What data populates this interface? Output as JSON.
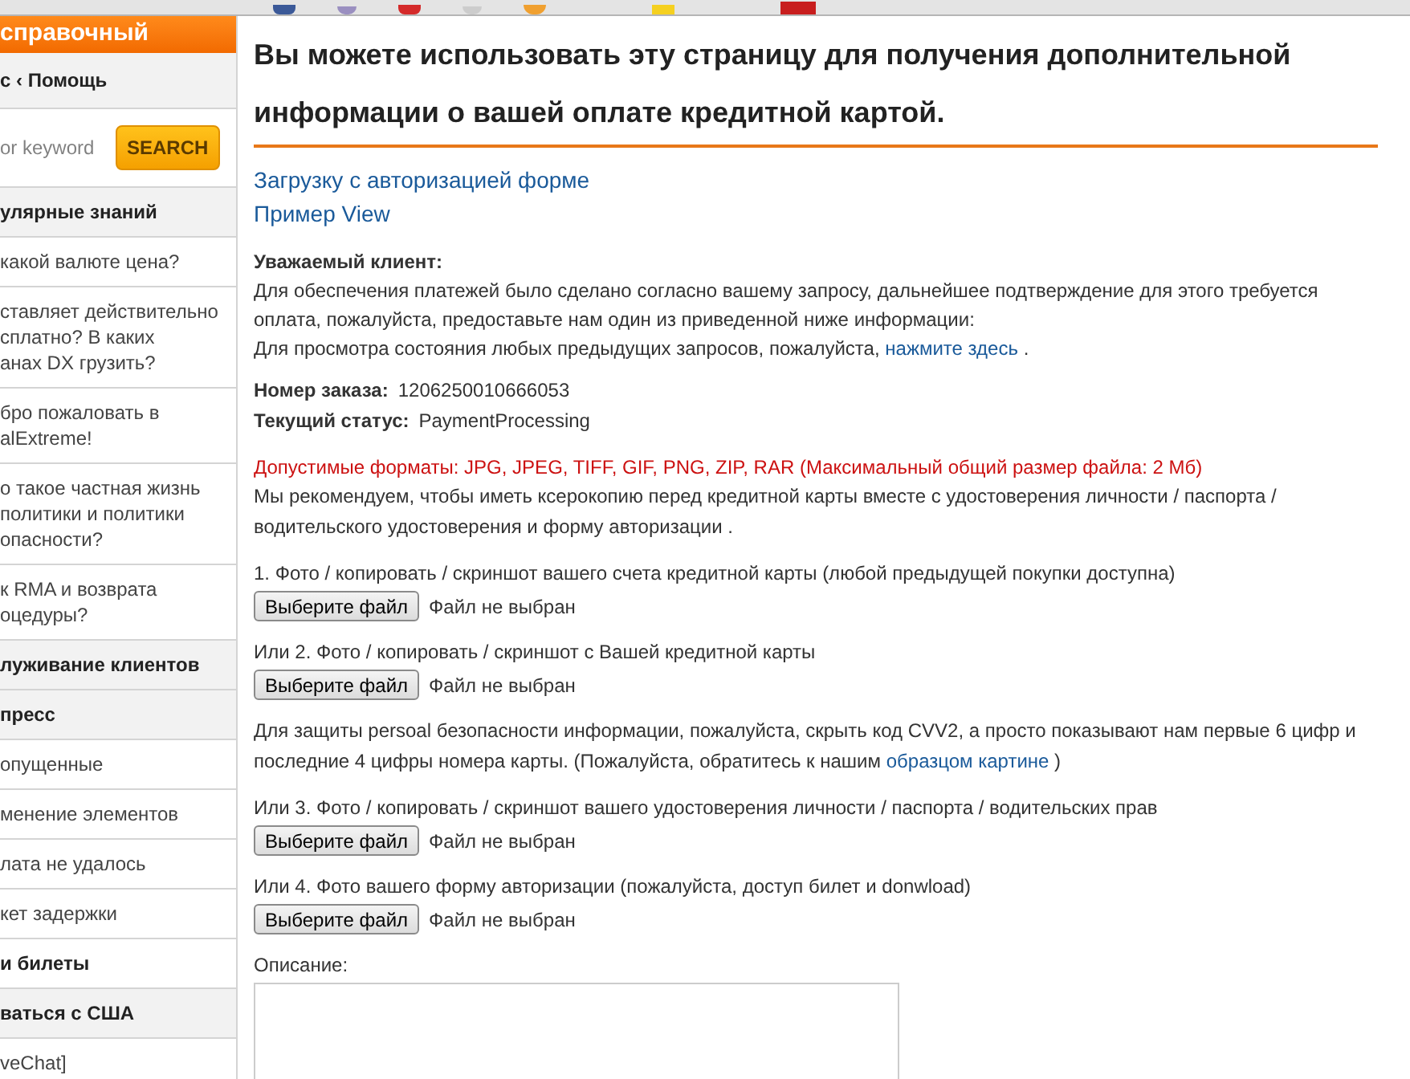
{
  "sidebar": {
    "title": "справочный",
    "breadcrumb": "с ‹ Помощь",
    "search": {
      "placeholder": "or keyword",
      "button": "SEARCH"
    },
    "items": [
      {
        "kind": "heading",
        "lines": [
          "улярные знаний"
        ]
      },
      {
        "kind": "link",
        "lines": [
          "какой валюте цена?"
        ]
      },
      {
        "kind": "link",
        "lines": [
          "ставляет действительно",
          "сплатно? В каких",
          "анах DX грузить?"
        ]
      },
      {
        "kind": "link",
        "lines": [
          "бро пожаловать в",
          "alExtreme!"
        ]
      },
      {
        "kind": "link",
        "lines": [
          "о такое частная жизнь",
          "политики и политики",
          "опасности?"
        ]
      },
      {
        "kind": "link",
        "lines": [
          "к RMA и возврата",
          "оцедуры?"
        ]
      },
      {
        "kind": "heading",
        "lines": [
          "луживание клиентов"
        ]
      },
      {
        "kind": "heading",
        "lines": [
          "пресс"
        ]
      },
      {
        "kind": "link",
        "lines": [
          "опущенные"
        ]
      },
      {
        "kind": "link",
        "lines": [
          "менение элементов"
        ]
      },
      {
        "kind": "link",
        "lines": [
          "лата не удалось"
        ]
      },
      {
        "kind": "link",
        "lines": [
          "кет задержки"
        ]
      },
      {
        "kind": "bold",
        "lines": [
          "и билеты"
        ]
      },
      {
        "kind": "heading",
        "lines": [
          "ваться с США"
        ]
      },
      {
        "kind": "link",
        "lines": [
          "veChat]"
        ]
      }
    ]
  },
  "main": {
    "title": "Вы можете использовать эту страницу для получения дополнительной информации о вашей оплате кредитной картой.",
    "links": [
      "Загрузку с авторизацией форме",
      "Пример View"
    ],
    "greeting": "Уважаемый клиент:",
    "intro": [
      "Для обеспечения платежей было сделано согласно вашему запросу, дальнейшее подтверждение для этого требуется оплата, пожалуйста, предоставьте нам один из приведенной ниже информации:"
    ],
    "status_line": {
      "text": "Для просмотра состояния любых предыдущих запросов, пожалуйста,",
      "link": "нажмите здесь",
      "after": "."
    },
    "order": [
      {
        "label": "Номер заказа:",
        "value": "1206250010666053"
      },
      {
        "label": "Текущий статус:",
        "value": "PaymentProcessing"
      }
    ],
    "formats": "Допустимые форматы: JPG, JPEG, TIFF, GIF, PNG, ZIP, RAR (Максимальный общий размер файла: 2 Мб)",
    "recommend": "Мы рекомендуем, чтобы иметь ксерокопию перед кредитной карты вместе с удостоверения личности / паспорта / водительского удостоверения и форму авторизации .",
    "uploads": [
      {
        "label": "1. Фото / копировать / скриншот вашего счета кредитной карты (любой предыдущей покупки доступна)",
        "button": "Выберите файл",
        "status": "Файл не выбран"
      },
      {
        "label": "Или 2. Фото / копировать / скриншот с Вашей кредитной карты",
        "button": "Выберите файл",
        "status": "Файл не выбран"
      },
      {
        "note": {
          "text": "Для защиты persoal безопасности информации, пожалуйста, скрыть код CVV2, а просто показывают нам первые 6 цифр и последние 4 цифры номера карты. (Пожалуйста, обратитесь к нашим",
          "link": "образцом картине",
          "after": ")"
        }
      },
      {
        "label": "Или 3. Фото / копировать / скриншот вашего удостоверения личности / паспорта / водительских прав",
        "button": "Выберите файл",
        "status": "Файл не выбран"
      },
      {
        "label": "Или 4. Фото вашего форму авторизации (пожалуйста, доступ билет и donwload)",
        "button": "Выберите файл",
        "status": "Файл не выбран"
      }
    ],
    "description_label": "Описание:"
  }
}
